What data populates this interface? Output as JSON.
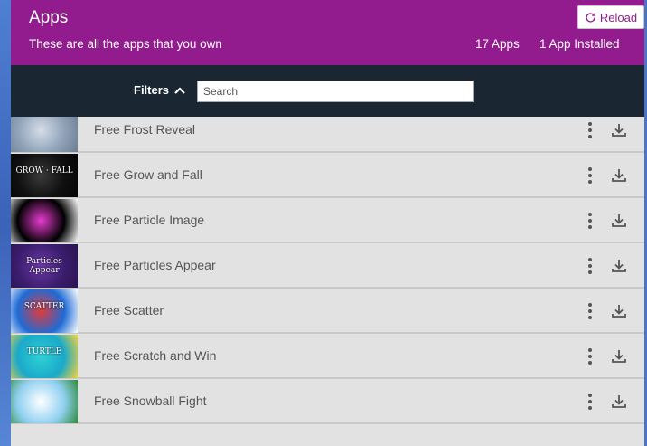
{
  "header": {
    "title": "Apps",
    "subtitle": "These are all the apps that you own",
    "app_count": "17 Apps",
    "installed_count": "1 App Installed",
    "reload_label": "Reload",
    "color": "#921b8e"
  },
  "filterbar": {
    "filters_label": "Filters",
    "search_placeholder": "Search",
    "search_value": ""
  },
  "apps": [
    {
      "name": "Free Frost Reveal",
      "thumb_text": "",
      "thumb_colors": [
        "#8fa2b8",
        "#d5dde8",
        "#6c7e94"
      ]
    },
    {
      "name": "Free Grow and Fall",
      "thumb_text": "GROW · FALL",
      "thumb_colors": [
        "#101010",
        "#3a3a3a",
        "#050505"
      ]
    },
    {
      "name": "Free Particle Image",
      "thumb_text": "",
      "thumb_colors": [
        "#000000",
        "#e83bd0",
        "#ffffff"
      ]
    },
    {
      "name": "Free Particles Appear",
      "thumb_text": "Particles Appear",
      "thumb_colors": [
        "#3b1d6e",
        "#6b3aa8",
        "#2a1450"
      ]
    },
    {
      "name": "Free Scatter",
      "thumb_text": "SCATTER",
      "thumb_colors": [
        "#1f6bd6",
        "#e23a3a",
        "#ffffff"
      ]
    },
    {
      "name": "Free Scratch and Win",
      "thumb_text": "TURTLE",
      "thumb_colors": [
        "#1ba9c9",
        "#2ed1d6",
        "#f6d33a"
      ]
    },
    {
      "name": "Free Snowball Fight",
      "thumb_text": "",
      "thumb_colors": [
        "#8fd0f0",
        "#ffffff",
        "#2e8b3a"
      ]
    }
  ],
  "icons": {
    "reload": "refresh-icon",
    "filters": "chevron-up-icon",
    "menu": "kebab-menu-icon",
    "download": "download-icon"
  }
}
